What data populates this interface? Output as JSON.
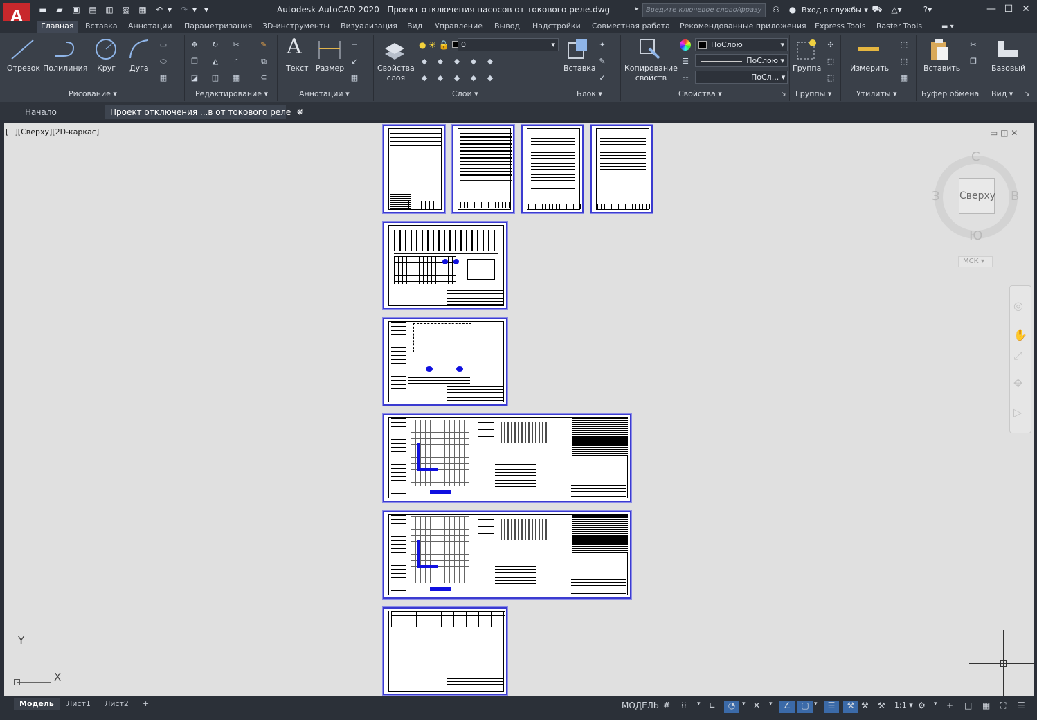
{
  "app": {
    "logo": "A",
    "title": "Autodesk AutoCAD 2020",
    "filename": "Проект отключения насосов от токового реле.dwg"
  },
  "search": {
    "placeholder": "Введите ключевое слово/фразу"
  },
  "account": {
    "signin": "Вход в службы"
  },
  "ribbon_tabs": [
    "Главная",
    "Вставка",
    "Аннотации",
    "Параметризация",
    "3D-инструменты",
    "Визуализация",
    "Вид",
    "Управление",
    "Вывод",
    "Надстройки",
    "Совместная работа",
    "Рекомендованные приложения",
    "Express Tools",
    "Raster Tools"
  ],
  "draw": {
    "line": "Отрезок",
    "polyline": "Полилиния",
    "circle": "Круг",
    "arc": "Дуга",
    "panel": "Рисование"
  },
  "modify": {
    "panel": "Редактирование"
  },
  "annotation": {
    "text": "Текст",
    "dimension": "Размер",
    "panel": "Аннотации"
  },
  "layers": {
    "props": "Свойства",
    "props2": "слоя",
    "current": "0",
    "panel": "Слои"
  },
  "block": {
    "insert": "Вставка",
    "panel": "Блок"
  },
  "properties": {
    "match": "Копирование",
    "match2": "свойств",
    "color": "ПоСлою",
    "lineweight": "ПоСлою",
    "linetype": "ПоСл...",
    "panel": "Свойства"
  },
  "groups": {
    "group": "Группа",
    "panel": "Группы"
  },
  "utilities": {
    "measure": "Измерить",
    "panel": "Утилиты"
  },
  "clipboard": {
    "paste": "Вставить",
    "panel": "Буфер обмена"
  },
  "view": {
    "base": "Базовый",
    "panel": "Вид"
  },
  "doc_tabs": {
    "start": "Начало",
    "active": "Проект отключения ...в от токового реле"
  },
  "viewport": {
    "label": "[−][Сверху][2D-каркас]"
  },
  "viewcube": {
    "north": "С",
    "south": "Ю",
    "west": "З",
    "east": "В",
    "face": "Сверху",
    "ucs": "МСК"
  },
  "ucs_axes": {
    "x": "X",
    "y": "Y"
  },
  "layout_tabs": [
    "Модель",
    "Лист1",
    "Лист2"
  ],
  "status": {
    "model": "МОДЕЛЬ",
    "scale": "1:1"
  }
}
